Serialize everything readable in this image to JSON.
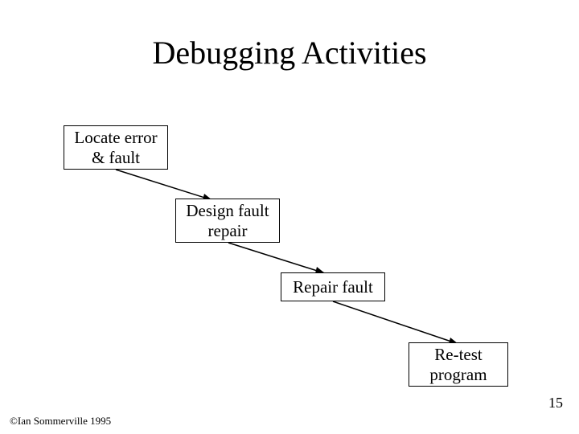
{
  "title": "Debugging Activities",
  "boxes": {
    "locate": "Locate error\n& fault",
    "design": "Design fault\nrepair",
    "repair": "Repair fault",
    "retest": "Re-test\nprogram"
  },
  "page_number": "15",
  "copyright": "©Ian Sommerville 1995"
}
